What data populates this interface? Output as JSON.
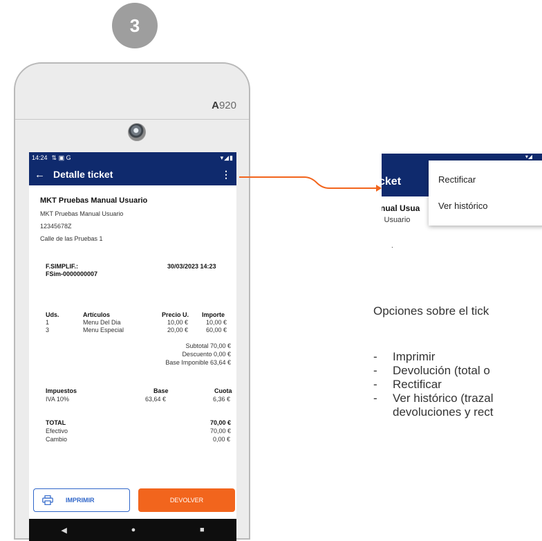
{
  "step": "3",
  "device": {
    "model_prefix": "A",
    "model_suffix": "920"
  },
  "screen": {
    "status": {
      "time": "14:24",
      "sys_icons": "⇅ ▣ G",
      "right_icons": "▾◢▮"
    },
    "appbar": {
      "back": "←",
      "title": "Detalle ticket",
      "more": "⋮"
    },
    "ticket": {
      "company": "MKT Pruebas Manual Usuario",
      "company_sub": "MKT Pruebas Manual Usuario",
      "tax_id": "12345678Z",
      "address": "Calle de las Pruebas 1",
      "doc_type": "F.SIMPLIF.:",
      "doc_number": "FSim-0000000007",
      "date": "30/03/2023 14:23",
      "headers": {
        "uds": "Uds.",
        "articulos": "Artículos",
        "precio": "Precio U.",
        "importe": "Importe"
      },
      "lines": [
        {
          "uds": "1",
          "articulo": "Menu Del Dia",
          "precio": "10,00 €",
          "importe": "10,00 €"
        },
        {
          "uds": "3",
          "articulo": "Menu Especial",
          "precio": "20,00 €",
          "importe": "60,00 €"
        }
      ],
      "subtotal": "Subtotal 70,00 €",
      "descuento": "Descuento 0,00 €",
      "base_imponible": "Base Imponible 63,64 €",
      "tax_headers": {
        "impuestos": "Impuestos",
        "base": "Base",
        "cuota": "Cuota"
      },
      "tax_line": {
        "name": "IVA 10%",
        "base": "63,64 €",
        "cuota": "6,36 €"
      },
      "total_label": "TOTAL",
      "total_value": "70,00 €",
      "efectivo_label": "Efectivo",
      "efectivo_value": "70,00 €",
      "cambio_label": "Cambio",
      "cambio_value": "0,00 €"
    },
    "buttons": {
      "print": "IMPRIMIR",
      "return": "DEVOLVER"
    },
    "nav": {
      "back": "◀",
      "home": "●",
      "recent": "■"
    }
  },
  "zoom": {
    "status_icons": "▾◢",
    "title_fragment": "cket",
    "body_line1": "nual Usua",
    "body_line2": "l Usuario",
    "dot": ".",
    "menu": [
      "Rectificar",
      "Ver histórico"
    ]
  },
  "description": {
    "intro": "Opciones sobre el tick",
    "options": [
      "Imprimir",
      "Devolución (total o",
      "Rectificar",
      "Ver histórico (trazal"
    ],
    "continuation": "devoluciones y rect",
    "dash": "-"
  },
  "colors": {
    "primary": "#0f2a6d",
    "accent": "#f2651d",
    "print_blue": "#2f66c9",
    "arrow": "#f2651d"
  }
}
